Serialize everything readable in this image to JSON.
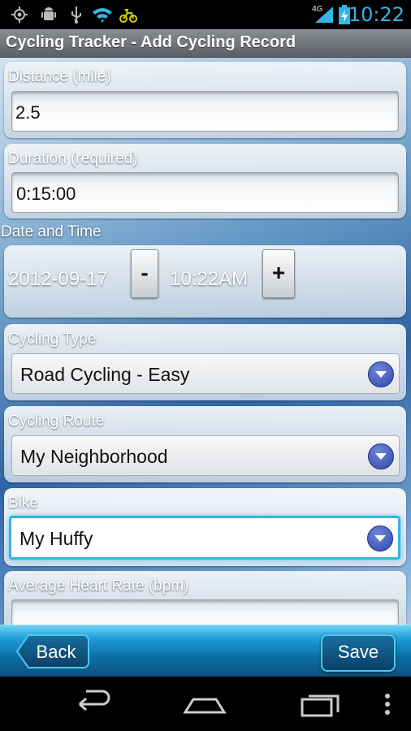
{
  "status_bar": {
    "time": "10:22",
    "network_type": "4G",
    "icons": [
      "gps-icon",
      "android-debug-icon",
      "usb-icon",
      "wifi-icon",
      "cycling-app-icon",
      "signal-icon",
      "battery-charging-icon"
    ]
  },
  "title_bar": {
    "title": "Cycling Tracker - Add Cycling Record"
  },
  "form": {
    "distance": {
      "label": "Distance (mile)",
      "value": "2.5"
    },
    "duration": {
      "label": "Duration (required)",
      "value": "0:15:00"
    },
    "date_time": {
      "label": "Date and Time",
      "date": "2012-09-17",
      "decrement_label": "-",
      "time": "10:22AM",
      "increment_label": "+"
    },
    "cycling_type": {
      "label": "Cycling Type",
      "selected": "Road Cycling - Easy"
    },
    "cycling_route": {
      "label": "Cycling Route",
      "selected": "My Neighborhood"
    },
    "bike": {
      "label": "Bike",
      "selected": "My Huffy"
    },
    "average_heart_rate": {
      "label": "Average Heart Rate (bpm)",
      "value": ""
    }
  },
  "toolbar": {
    "back_label": "Back",
    "save_label": "Save"
  },
  "system_nav": {
    "icons": [
      "back-icon",
      "home-icon",
      "recent-apps-icon",
      "overflow-menu-icon"
    ]
  },
  "colors": {
    "accent": "#33b5e5",
    "toolbar": "#1f9ed8",
    "dropdown_chevron": "#3a55b5"
  }
}
